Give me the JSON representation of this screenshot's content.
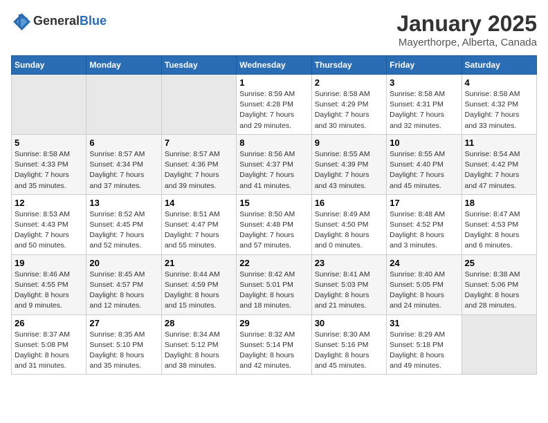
{
  "header": {
    "logo_general": "General",
    "logo_blue": "Blue",
    "month": "January 2025",
    "location": "Mayerthorpe, Alberta, Canada"
  },
  "weekdays": [
    "Sunday",
    "Monday",
    "Tuesday",
    "Wednesday",
    "Thursday",
    "Friday",
    "Saturday"
  ],
  "weeks": [
    [
      {
        "day": "",
        "info": ""
      },
      {
        "day": "",
        "info": ""
      },
      {
        "day": "",
        "info": ""
      },
      {
        "day": "1",
        "info": "Sunrise: 8:59 AM\nSunset: 4:28 PM\nDaylight: 7 hours\nand 29 minutes."
      },
      {
        "day": "2",
        "info": "Sunrise: 8:58 AM\nSunset: 4:29 PM\nDaylight: 7 hours\nand 30 minutes."
      },
      {
        "day": "3",
        "info": "Sunrise: 8:58 AM\nSunset: 4:31 PM\nDaylight: 7 hours\nand 32 minutes."
      },
      {
        "day": "4",
        "info": "Sunrise: 8:58 AM\nSunset: 4:32 PM\nDaylight: 7 hours\nand 33 minutes."
      }
    ],
    [
      {
        "day": "5",
        "info": "Sunrise: 8:58 AM\nSunset: 4:33 PM\nDaylight: 7 hours\nand 35 minutes."
      },
      {
        "day": "6",
        "info": "Sunrise: 8:57 AM\nSunset: 4:34 PM\nDaylight: 7 hours\nand 37 minutes."
      },
      {
        "day": "7",
        "info": "Sunrise: 8:57 AM\nSunset: 4:36 PM\nDaylight: 7 hours\nand 39 minutes."
      },
      {
        "day": "8",
        "info": "Sunrise: 8:56 AM\nSunset: 4:37 PM\nDaylight: 7 hours\nand 41 minutes."
      },
      {
        "day": "9",
        "info": "Sunrise: 8:55 AM\nSunset: 4:39 PM\nDaylight: 7 hours\nand 43 minutes."
      },
      {
        "day": "10",
        "info": "Sunrise: 8:55 AM\nSunset: 4:40 PM\nDaylight: 7 hours\nand 45 minutes."
      },
      {
        "day": "11",
        "info": "Sunrise: 8:54 AM\nSunset: 4:42 PM\nDaylight: 7 hours\nand 47 minutes."
      }
    ],
    [
      {
        "day": "12",
        "info": "Sunrise: 8:53 AM\nSunset: 4:43 PM\nDaylight: 7 hours\nand 50 minutes."
      },
      {
        "day": "13",
        "info": "Sunrise: 8:52 AM\nSunset: 4:45 PM\nDaylight: 7 hours\nand 52 minutes."
      },
      {
        "day": "14",
        "info": "Sunrise: 8:51 AM\nSunset: 4:47 PM\nDaylight: 7 hours\nand 55 minutes."
      },
      {
        "day": "15",
        "info": "Sunrise: 8:50 AM\nSunset: 4:48 PM\nDaylight: 7 hours\nand 57 minutes."
      },
      {
        "day": "16",
        "info": "Sunrise: 8:49 AM\nSunset: 4:50 PM\nDaylight: 8 hours\nand 0 minutes."
      },
      {
        "day": "17",
        "info": "Sunrise: 8:48 AM\nSunset: 4:52 PM\nDaylight: 8 hours\nand 3 minutes."
      },
      {
        "day": "18",
        "info": "Sunrise: 8:47 AM\nSunset: 4:53 PM\nDaylight: 8 hours\nand 6 minutes."
      }
    ],
    [
      {
        "day": "19",
        "info": "Sunrise: 8:46 AM\nSunset: 4:55 PM\nDaylight: 8 hours\nand 9 minutes."
      },
      {
        "day": "20",
        "info": "Sunrise: 8:45 AM\nSunset: 4:57 PM\nDaylight: 8 hours\nand 12 minutes."
      },
      {
        "day": "21",
        "info": "Sunrise: 8:44 AM\nSunset: 4:59 PM\nDaylight: 8 hours\nand 15 minutes."
      },
      {
        "day": "22",
        "info": "Sunrise: 8:42 AM\nSunset: 5:01 PM\nDaylight: 8 hours\nand 18 minutes."
      },
      {
        "day": "23",
        "info": "Sunrise: 8:41 AM\nSunset: 5:03 PM\nDaylight: 8 hours\nand 21 minutes."
      },
      {
        "day": "24",
        "info": "Sunrise: 8:40 AM\nSunset: 5:05 PM\nDaylight: 8 hours\nand 24 minutes."
      },
      {
        "day": "25",
        "info": "Sunrise: 8:38 AM\nSunset: 5:06 PM\nDaylight: 8 hours\nand 28 minutes."
      }
    ],
    [
      {
        "day": "26",
        "info": "Sunrise: 8:37 AM\nSunset: 5:08 PM\nDaylight: 8 hours\nand 31 minutes."
      },
      {
        "day": "27",
        "info": "Sunrise: 8:35 AM\nSunset: 5:10 PM\nDaylight: 8 hours\nand 35 minutes."
      },
      {
        "day": "28",
        "info": "Sunrise: 8:34 AM\nSunset: 5:12 PM\nDaylight: 8 hours\nand 38 minutes."
      },
      {
        "day": "29",
        "info": "Sunrise: 8:32 AM\nSunset: 5:14 PM\nDaylight: 8 hours\nand 42 minutes."
      },
      {
        "day": "30",
        "info": "Sunrise: 8:30 AM\nSunset: 5:16 PM\nDaylight: 8 hours\nand 45 minutes."
      },
      {
        "day": "31",
        "info": "Sunrise: 8:29 AM\nSunset: 5:18 PM\nDaylight: 8 hours\nand 49 minutes."
      },
      {
        "day": "",
        "info": ""
      }
    ]
  ]
}
